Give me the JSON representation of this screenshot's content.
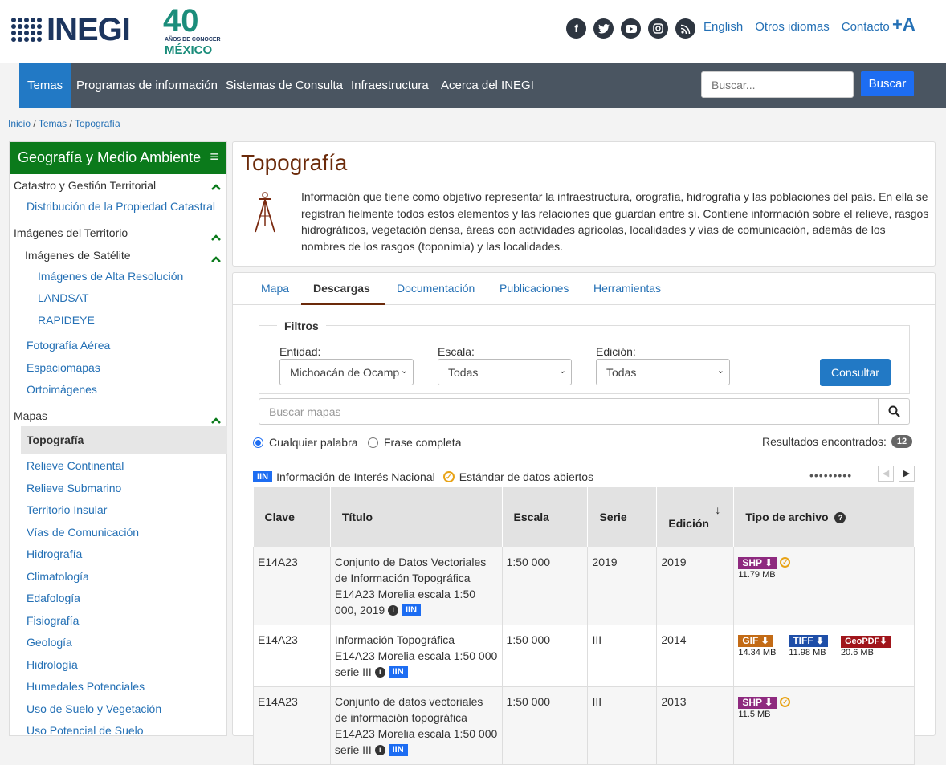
{
  "header": {
    "logo_text": "INEGI",
    "anniversary_number": "40",
    "anniversary_sub": "AÑOS DE CONOCER",
    "anniversary_country": "MÉXICO",
    "social_icons": [
      "facebook-icon",
      "twitter-icon",
      "youtube-icon",
      "instagram-icon",
      "rss-icon"
    ],
    "links": {
      "english": "English",
      "other_languages": "Otros idiomas",
      "contact": "Contacto"
    },
    "font_size_toggle": "+A"
  },
  "nav": {
    "items": [
      "Temas",
      "Programas de información",
      "Sistemas de Consulta",
      "Infraestructura",
      "Acerca del INEGI"
    ],
    "active_index": 0,
    "search_placeholder": "Buscar...",
    "search_button": "Buscar"
  },
  "breadcrumb": {
    "items": [
      "Inicio",
      "Temas",
      "Topografía"
    ],
    "separator": "/"
  },
  "sidebar": {
    "title": "Geografía y Medio Ambiente",
    "sections": [
      {
        "label": "Catastro y Gestión Territorial",
        "items": [
          "Distribución de la Propiedad Catastral"
        ]
      },
      {
        "label": "Imágenes del Territorio",
        "sub_label": "Imágenes de Satélite",
        "sub_items": [
          "Imágenes de Alta Resolución",
          "LANDSAT",
          "RAPIDEYE"
        ],
        "items": [
          "Fotografía Aérea",
          "Espaciomapas",
          "Ortoimágenes"
        ]
      },
      {
        "label": "Mapas",
        "active_item": "Topografía",
        "items": [
          "Relieve Continental",
          "Relieve Submarino",
          "Territorio Insular",
          "Vías de Comunicación",
          "Hidrografía",
          "Climatología",
          "Edafología",
          "Fisiografía",
          "Geología",
          "Hidrología",
          "Humedales Potenciales",
          "Uso de Suelo y Vegetación",
          "Uso Potencial de Suelo"
        ]
      }
    ]
  },
  "intro": {
    "title": "Topografía",
    "description": "Información que tiene como objetivo representar la infraestructura, orografía, hidrografía y las poblaciones del país. En ella se registran fielmente todos estos elementos y las relaciones que guardan entre sí. Contiene información sobre el relieve, rasgos hidrográficos, vegetación densa, áreas con actividades agrícolas, localidades y vías de comunicación, además de los nombres de los rasgos (toponimia) y las localidades."
  },
  "tabs": {
    "items": [
      "Mapa",
      "Descargas",
      "Documentación",
      "Publicaciones",
      "Herramientas"
    ],
    "active_index": 1
  },
  "filters": {
    "legend": "Filtros",
    "entidad_label": "Entidad:",
    "entidad_value": "Michoacán de Ocampo",
    "escala_label": "Escala:",
    "escala_value": "Todas",
    "edicion_label": "Edición:",
    "edicion_value": "Todas",
    "consultar": "Consultar"
  },
  "map_search": {
    "placeholder": "Buscar mapas"
  },
  "search_mode": {
    "any_word": "Cualquier palabra",
    "full_phrase": "Frase completa",
    "selected": "any_word"
  },
  "results": {
    "label": "Resultados encontrados:",
    "count": "12"
  },
  "legend": {
    "iin_badge": "IIN",
    "iin_text": "Información de Interés Nacional",
    "std_text": "Estándar de datos abiertos"
  },
  "table": {
    "headers": [
      "Clave",
      "Título",
      "Escala",
      "Serie",
      "Edición",
      "Tipo de archivo"
    ],
    "rows": [
      {
        "clave": "E14A23",
        "titulo": "Conjunto de Datos Vectoriales de Información Topográfica E14A23 Morelia escala 1:50 000, 2019",
        "escala": "1:50 000",
        "serie": "2019",
        "edicion": "2019",
        "files": [
          {
            "type": "SHP",
            "size": "11.79 MB",
            "color": "#8e2a7f"
          }
        ],
        "standard": true
      },
      {
        "clave": "E14A23",
        "titulo": "Información Topográfica E14A23 Morelia escala 1:50 000 serie III",
        "escala": "1:50 000",
        "serie": "III",
        "edicion": "2014",
        "files": [
          {
            "type": "GIF",
            "size": "14.34 MB",
            "color": "#c36b16"
          },
          {
            "type": "TIFF",
            "size": "11.98 MB",
            "color": "#1f4fa8"
          },
          {
            "type": "GeoPDF",
            "size": "20.6 MB",
            "color": "#a0151b"
          }
        ],
        "standard": false
      },
      {
        "clave": "E14A23",
        "titulo": "Conjunto de datos vectoriales de información topográfica E14A23 Morelia escala 1:50 000 serie III",
        "escala": "1:50 000",
        "serie": "III",
        "edicion": "2013",
        "files": [
          {
            "type": "SHP",
            "size": "11.5 MB",
            "color": "#8e2a7f"
          }
        ],
        "standard": true
      }
    ]
  },
  "colors": {
    "nav_bg": "#4a5561",
    "nav_active": "#2279c5",
    "sidebar_head": "#0b7a1b",
    "title": "#6b2a0a",
    "link": "#2470b5",
    "iin": "#1d6df2"
  }
}
